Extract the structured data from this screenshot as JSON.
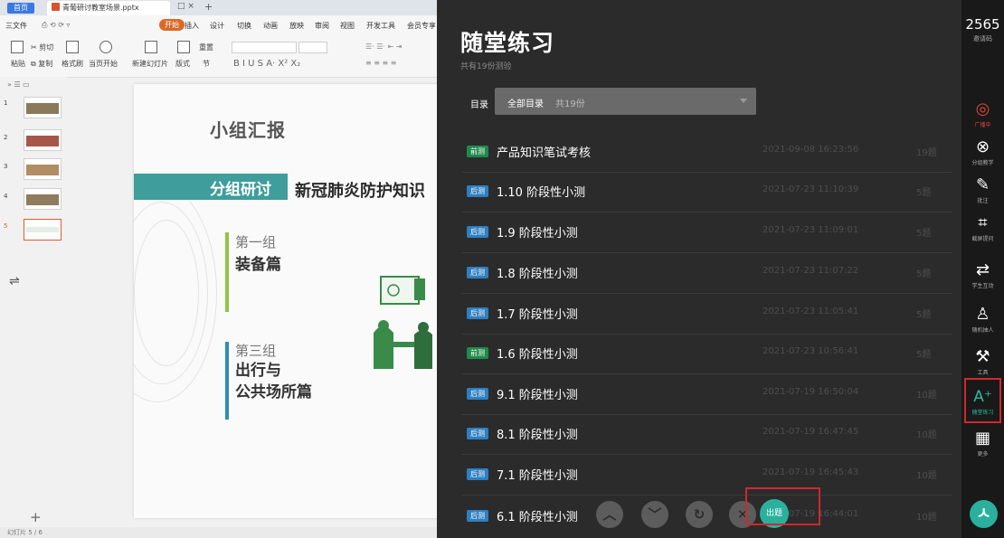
{
  "wps": {
    "home_tab": "首页",
    "doc_tab": "青葡研讨教室场景.pptx",
    "menu": [
      "三文件",
      "开始",
      "插入",
      "设计",
      "切换",
      "动画",
      "放映",
      "审阅",
      "视图",
      "开发工具",
      "会员专享"
    ],
    "ribbon": {
      "paste": "粘贴",
      "cut": "剪切",
      "copy": "复制",
      "format_painter": "格式刷",
      "from_start": "当页开始",
      "new_slide": "新建幻灯片",
      "layout": "版式",
      "section": "节",
      "reset": "重置"
    },
    "slide": {
      "title": "小组汇报",
      "tag": "分组研讨",
      "headline": "新冠肺炎防护知识",
      "group1_label": "第一组",
      "group1_title": "装备篇",
      "group3_label": "第三组",
      "group3_title_line1": "出行与",
      "group3_title_line2": "公共场所篇"
    },
    "thumb_numbers": [
      "1",
      "2",
      "3",
      "4",
      "5"
    ],
    "status": "幻灯片 5 / 6"
  },
  "quiz": {
    "title": "随堂练习",
    "subtitle": "共有19份测验",
    "dir_label": "目录",
    "dir_value": "全部目录",
    "dir_count": "共19份",
    "items": [
      {
        "badge": "前测",
        "badge_color": "#1f8a4c",
        "name": "产品知识笔试考核",
        "time": "2021-09-08 16:23:56",
        "count": "19题"
      },
      {
        "badge": "后测",
        "badge_color": "#2e7fc1",
        "name": "1.10 阶段性小测",
        "time": "2021-07-23 11:10:39",
        "count": "5题"
      },
      {
        "badge": "后测",
        "badge_color": "#2e7fc1",
        "name": "1.9 阶段性小测",
        "time": "2021-07-23 11:09:01",
        "count": "5题"
      },
      {
        "badge": "后测",
        "badge_color": "#2e7fc1",
        "name": "1.8 阶段性小测",
        "time": "2021-07-23 11:07:22",
        "count": "5题"
      },
      {
        "badge": "后测",
        "badge_color": "#2e7fc1",
        "name": "1.7 阶段性小测",
        "time": "2021-07-23 11:05:41",
        "count": "5题"
      },
      {
        "badge": "前测",
        "badge_color": "#1f8a4c",
        "name": "1.6 阶段性小测",
        "time": "2021-07-23 10:56:41",
        "count": "5题"
      },
      {
        "badge": "后测",
        "badge_color": "#2e7fc1",
        "name": "9.1 阶段性小测",
        "time": "2021-07-19 16:50:04",
        "count": "10题"
      },
      {
        "badge": "后测",
        "badge_color": "#2e7fc1",
        "name": "8.1 阶段性小测",
        "time": "2021-07-19 16:47:45",
        "count": "10题"
      },
      {
        "badge": "后测",
        "badge_color": "#2e7fc1",
        "name": "7.1 阶段性小测",
        "time": "2021-07-19 16:45:43",
        "count": "10题"
      },
      {
        "badge": "后测",
        "badge_color": "#2e7fc1",
        "name": "6.1 阶段性小测",
        "time": "2021-07-19 16:44:01",
        "count": "10题"
      }
    ],
    "publish_label": "出题",
    "controls": [
      "chevron-up-icon",
      "chevron-down-icon",
      "refresh-icon",
      "close-icon"
    ]
  },
  "sidebar": {
    "room_code": "2565",
    "room_label": "邀请码",
    "items": [
      {
        "icon": "broadcast-icon",
        "glyph": "◎",
        "label": "广播中",
        "color": "#e0453b"
      },
      {
        "icon": "group-icon",
        "glyph": "⊗",
        "label": "分组教学",
        "color": "#ffffff"
      },
      {
        "icon": "annotate-icon",
        "glyph": "✎",
        "label": "批注",
        "color": "#ffffff"
      },
      {
        "icon": "crop-icon",
        "glyph": "⌗",
        "label": "截屏提问",
        "color": "#ffffff"
      },
      {
        "icon": "interaction-icon",
        "glyph": "⇄",
        "label": "学生互动",
        "color": "#ffffff"
      },
      {
        "icon": "random-person-icon",
        "glyph": "♙",
        "label": "随机抽人",
        "color": "#ffffff"
      },
      {
        "icon": "tool-icon",
        "glyph": "⚒",
        "label": "工具",
        "color": "#ffffff"
      },
      {
        "icon": "quiz-icon",
        "glyph": "A⁺",
        "label": "随堂练习",
        "color": "#2fb8a4"
      },
      {
        "icon": "more-icon",
        "glyph": "▦",
        "label": "更多",
        "color": "#ffffff"
      }
    ],
    "avatar_glyph": "ㅅ"
  }
}
